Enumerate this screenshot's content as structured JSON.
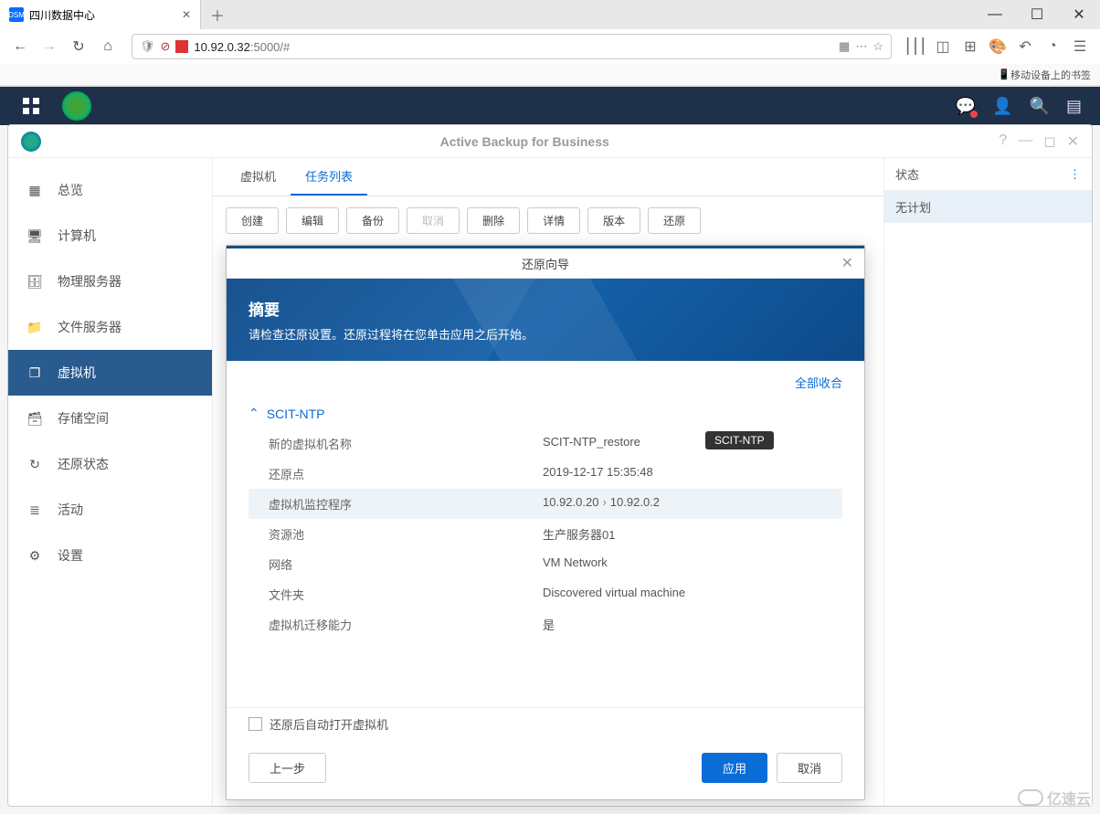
{
  "browser": {
    "tab_title": "四川数据中心",
    "url_host": "10.92.0.32",
    "url_port_path": ":5000/#",
    "bookmark_hint": "移动设备上的书签"
  },
  "app": {
    "title": "Active Backup for Business"
  },
  "sidebar": {
    "items": [
      {
        "label": "总览"
      },
      {
        "label": "计算机"
      },
      {
        "label": "物理服务器"
      },
      {
        "label": "文件服务器"
      },
      {
        "label": "虚拟机"
      },
      {
        "label": "存储空间"
      },
      {
        "label": "还原状态"
      },
      {
        "label": "活动"
      },
      {
        "label": "设置"
      }
    ],
    "active_index": 4
  },
  "tabs": {
    "items": [
      "虚拟机",
      "任务列表"
    ],
    "active_index": 1
  },
  "toolbar": {
    "create": "创建",
    "edit": "编辑",
    "backup": "备份",
    "cancel": "取消",
    "delete": "删除",
    "details": "详情",
    "version": "版本",
    "restore": "还原"
  },
  "right_panel": {
    "header": "状态",
    "item": "无计划"
  },
  "modal": {
    "title": "还原向导",
    "banner_title": "摘要",
    "banner_sub": "请检查还原设置。还原过程将在您单击应用之后开始。",
    "collapse_all": "全部收合",
    "section": "SCIT-NTP",
    "rows": [
      {
        "label": "新的虚拟机名称",
        "value": "SCIT-NTP_restore",
        "tooltip": "SCIT-NTP"
      },
      {
        "label": "还原点",
        "value": "2019-12-17 15:35:48"
      },
      {
        "label": "虚拟机监控程序",
        "value_from": "10.92.0.20",
        "value_to": "10.92.0.2",
        "hl": true
      },
      {
        "label": "资源池",
        "value": "生产服务器01"
      },
      {
        "label": "网络",
        "value": "VM Network"
      },
      {
        "label": "文件夹",
        "value": "Discovered virtual machine"
      },
      {
        "label": "虚拟机迁移能力",
        "value": "是"
      }
    ],
    "checkbox": "还原后自动打开虚拟机",
    "back": "上一步",
    "apply": "应用",
    "cancel": "取消"
  },
  "watermark": "亿速云"
}
